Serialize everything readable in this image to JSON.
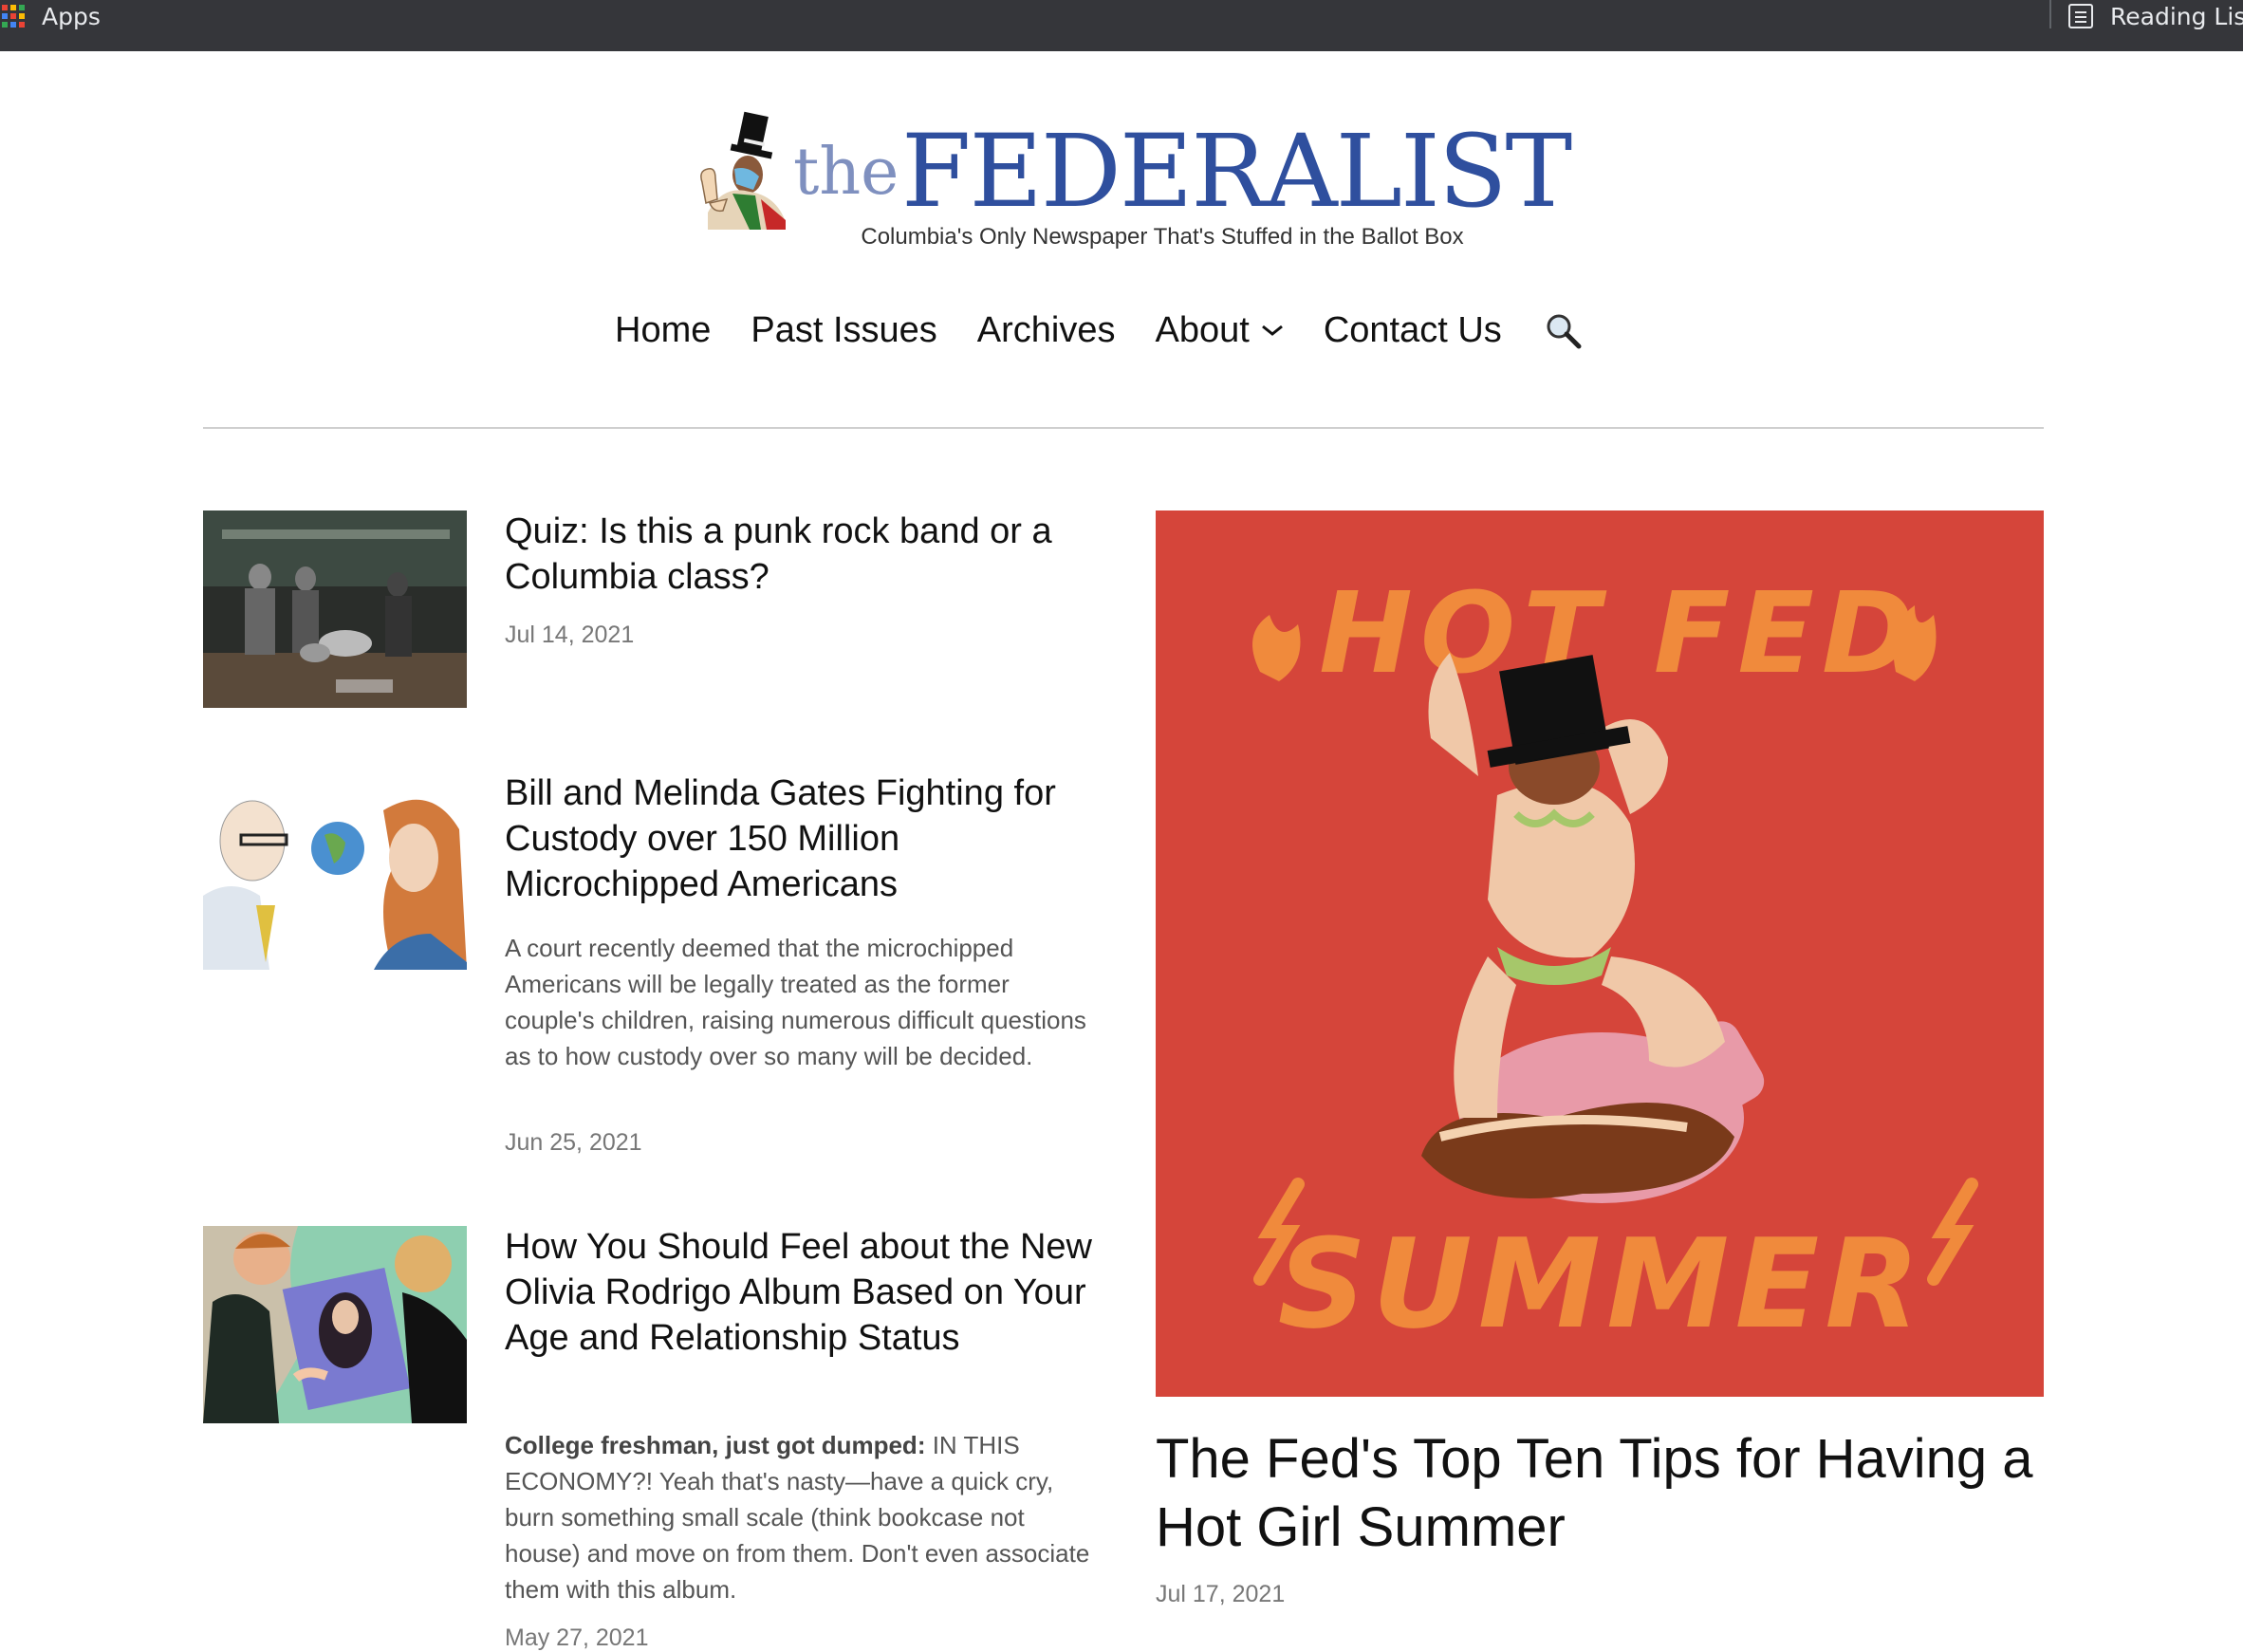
{
  "browser": {
    "apps_label": "Apps",
    "reading_list_label": "Reading List"
  },
  "masthead": {
    "logo_the": "the",
    "logo_name": "FEDERALIST",
    "tagline": "Columbia's Only Newspaper That's Stuffed in the Ballot Box"
  },
  "nav": {
    "items": [
      "Home",
      "Past Issues",
      "Archives",
      "About",
      "Contact Us"
    ]
  },
  "articles": [
    {
      "title": "Quiz: Is this a punk rock band or a Columbia class?",
      "excerpt": "",
      "date": "Jul 14, 2021"
    },
    {
      "title": "Bill and Melinda Gates Fighting for Custody over 150 Million Microchipped Americans",
      "excerpt": "A court recently deemed that the microchipped Americans will be legally treated as the former couple's children, raising numerous difficult questions as to how custody over so many will be decided.",
      "date": "Jun 25, 2021"
    },
    {
      "title": "How You Should Feel about the New Olivia Rodrigo Album Based on Your Age and Relationship Status",
      "excerpt_bold": "College freshman, just got dumped:",
      "excerpt": " IN THIS ECONOMY?! Yeah that's nasty—have a quick cry, burn something small scale (think bookcase not house) and move on from them. Don't even associate them with this album.",
      "date": "May 27, 2021"
    }
  ],
  "featured": {
    "image_text_top": "HOT FED",
    "image_text_bottom": "SUMMER",
    "title": "The Fed's Top Ten Tips for Having a Hot Girl Summer",
    "date": "Jul 17, 2021"
  },
  "colors": {
    "bookmarks_bg": "#35363a",
    "logo_blue": "#2f4f9e",
    "logo_light_blue": "#7f90bf",
    "featured_bg": "#d5453a",
    "featured_text": "#f08a3c"
  }
}
